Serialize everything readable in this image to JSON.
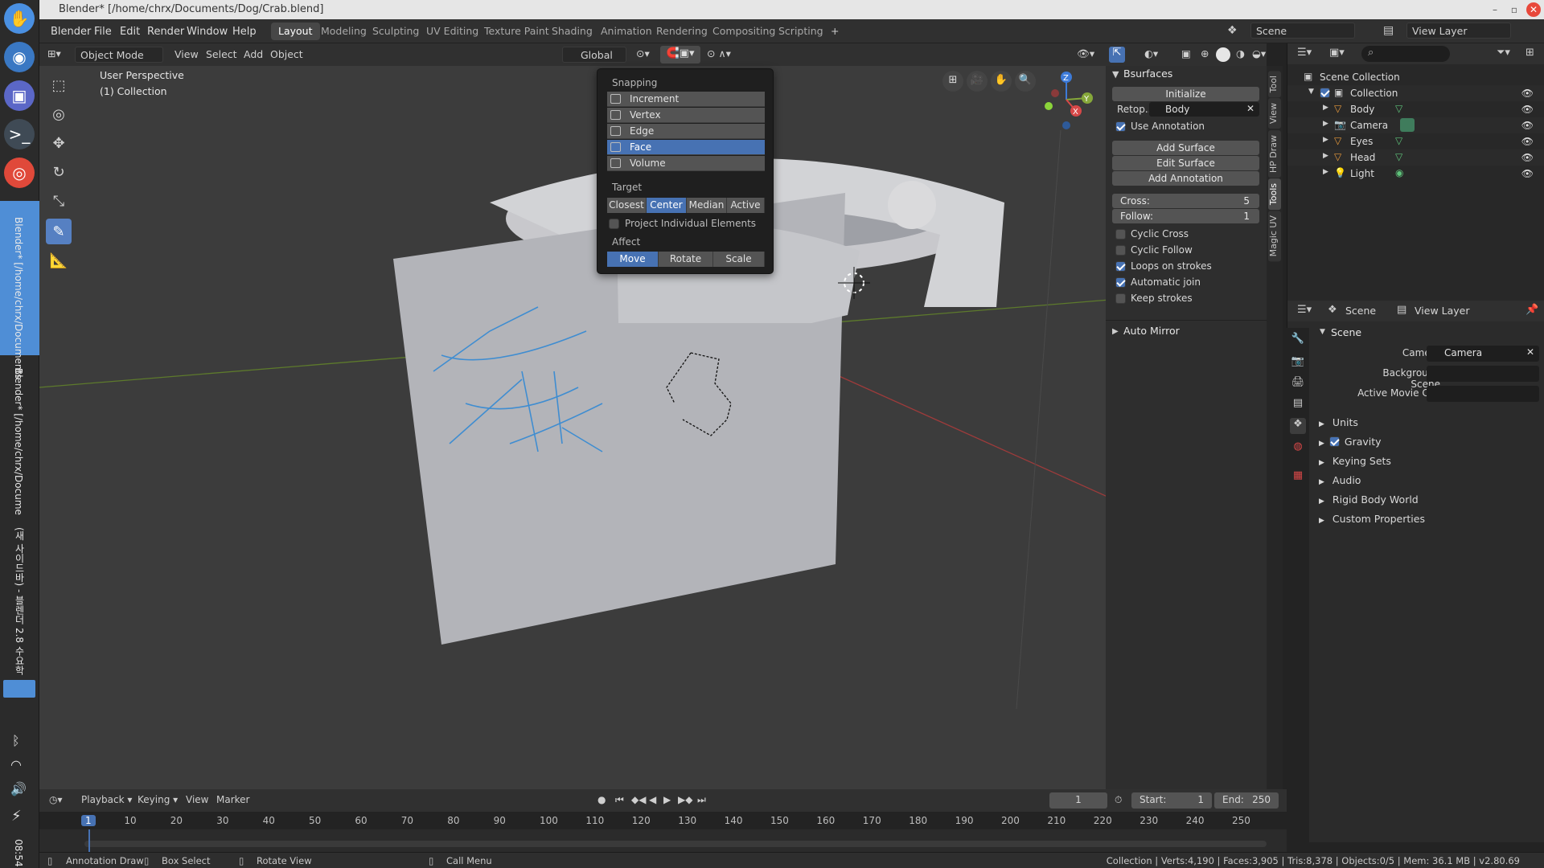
{
  "os": {
    "taskbar_text_1": "Blender* [/home/chrx/Documents",
    "taskbar_text_2": "Blender* [/home/chrx/Docume",
    "taskbar_text_3": "(새 사이드바) - 블렌더 2.8 수요학",
    "clock": "08:54"
  },
  "title": "Blender* [/home/chrx/Documents/Dog/Crab.blend]",
  "menu": [
    "Blender",
    "File",
    "Edit",
    "Render",
    "Window",
    "Help"
  ],
  "workspaces": [
    "Layout",
    "Modeling",
    "Sculpting",
    "UV Editing",
    "Texture Paint",
    "Shading",
    "Animation",
    "Rendering",
    "Compositing",
    "Scripting"
  ],
  "active_workspace": "Layout",
  "scene_name": "Scene",
  "view_layer_name": "View Layer",
  "viewport_header": {
    "mode": "Object Mode",
    "menus": [
      "View",
      "Select",
      "Add",
      "Object"
    ],
    "orientation": "Global"
  },
  "viewport": {
    "perspective": "User Perspective",
    "collection": "(1) Collection"
  },
  "snapping": {
    "title": "Snapping",
    "options": [
      "Increment",
      "Vertex",
      "Edge",
      "Face",
      "Volume"
    ],
    "selected": "Face",
    "target_label": "Target",
    "targets": [
      "Closest",
      "Center",
      "Median",
      "Active"
    ],
    "target_selected": "Center",
    "project_label": "Project Individual Elements",
    "affect_label": "Affect",
    "affects": [
      "Move",
      "Rotate",
      "Scale"
    ],
    "affect_selected": "Move"
  },
  "bsurfaces": {
    "title": "Bsurfaces",
    "initialize": "Initialize",
    "retopo_label": "Retop..",
    "retopo_value": "Body",
    "use_annotation": "Use Annotation",
    "buttons": [
      "Add Surface",
      "Edit Surface",
      "Add Annotation"
    ],
    "cross_label": "Cross:",
    "cross_value": "5",
    "follow_label": "Follow:",
    "follow_value": "1",
    "checks": [
      {
        "label": "Cyclic Cross",
        "on": false
      },
      {
        "label": "Cyclic Follow",
        "on": false
      },
      {
        "label": "Loops on strokes",
        "on": true
      },
      {
        "label": "Automatic join",
        "on": true
      },
      {
        "label": "Keep strokes",
        "on": false
      }
    ],
    "auto_mirror": "Auto Mirror"
  },
  "npanel_tabs": [
    "Tool",
    "View",
    "HP Draw",
    "Tools",
    "Magic UV"
  ],
  "outliner": {
    "root": "Scene Collection",
    "collection": "Collection",
    "items": [
      "Body",
      "Camera",
      "Eyes",
      "Head",
      "Light"
    ]
  },
  "properties": {
    "header_scene": "Scene",
    "header_view_layer": "View Layer",
    "section": "Scene",
    "camera_label": "Camera",
    "camera_value": "Camera",
    "bg_scene_label": "Background Scene",
    "movie_clip_label": "Active Movie Clip",
    "subpanels": [
      "Units",
      "Gravity",
      "Keying Sets",
      "Audio",
      "Rigid Body World",
      "Custom Properties"
    ]
  },
  "timeline": {
    "menus": [
      "Playback",
      "Keying",
      "View",
      "Marker"
    ],
    "current_frame": "1",
    "start_label": "Start:",
    "start": "1",
    "end_label": "End:",
    "end": "250",
    "ticks": [
      "1",
      "10",
      "20",
      "30",
      "40",
      "50",
      "60",
      "70",
      "80",
      "90",
      "100",
      "110",
      "120",
      "130",
      "140",
      "150",
      "160",
      "170",
      "180",
      "190",
      "200",
      "210",
      "220",
      "230",
      "240",
      "250"
    ]
  },
  "status": {
    "annotation": "Annotation Draw",
    "box_select": "Box Select",
    "rotate_view": "Rotate View",
    "call_menu": "Call Menu",
    "stats": "Collection | Verts:4,190 | Faces:3,905 | Tris:8,378 | Objects:0/5 | Mem: 36.1 MB | v2.80.69"
  }
}
